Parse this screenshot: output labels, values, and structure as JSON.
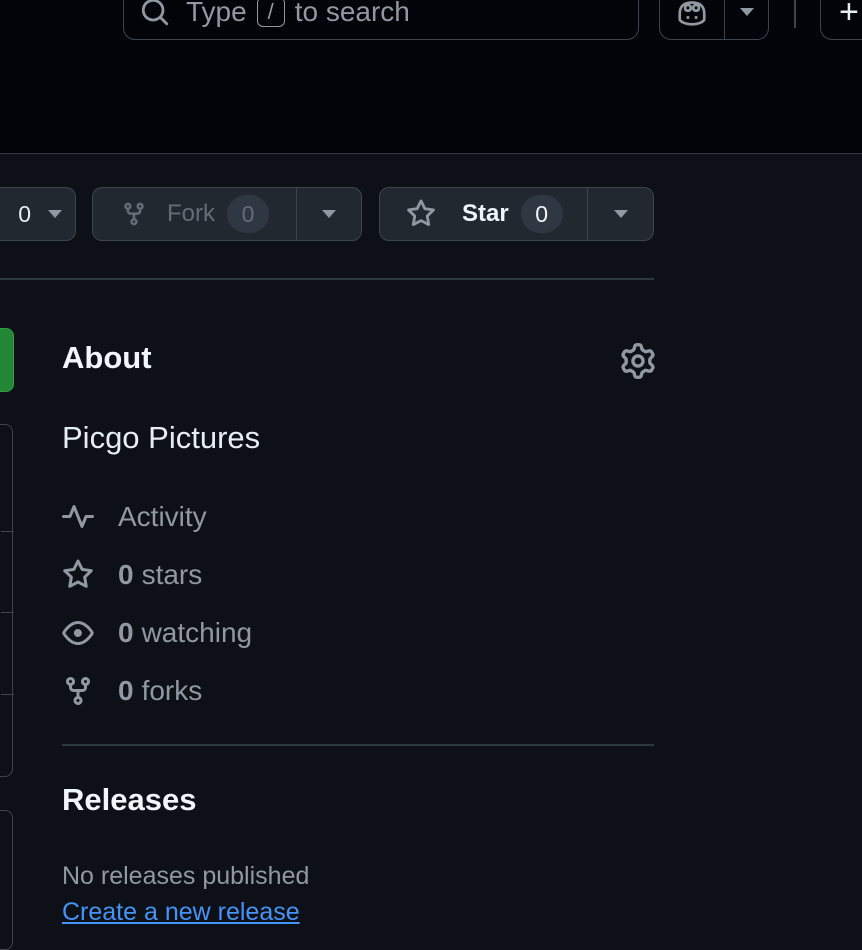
{
  "header": {
    "search": {
      "text_before": "Type",
      "slash_key": "/",
      "text_after": "to search"
    },
    "plus_label": "+"
  },
  "repo_actions": {
    "watch_count": "0",
    "fork": {
      "label": "Fork",
      "count": "0"
    },
    "star": {
      "label": "Star",
      "count": "0"
    }
  },
  "about": {
    "title": "About",
    "description": "Picgo Pictures",
    "activity_label": "Activity",
    "stars": {
      "count": "0",
      "label": "stars"
    },
    "watching": {
      "count": "0",
      "label": "watching"
    },
    "forks": {
      "count": "0",
      "label": "forks"
    }
  },
  "releases": {
    "title": "Releases",
    "empty_text": "No releases published",
    "create_link": "Create a new release"
  },
  "colors": {
    "background": "#0d1117",
    "header_background": "#010409",
    "accent_link": "#4493f8",
    "primary_button": "#238636"
  }
}
